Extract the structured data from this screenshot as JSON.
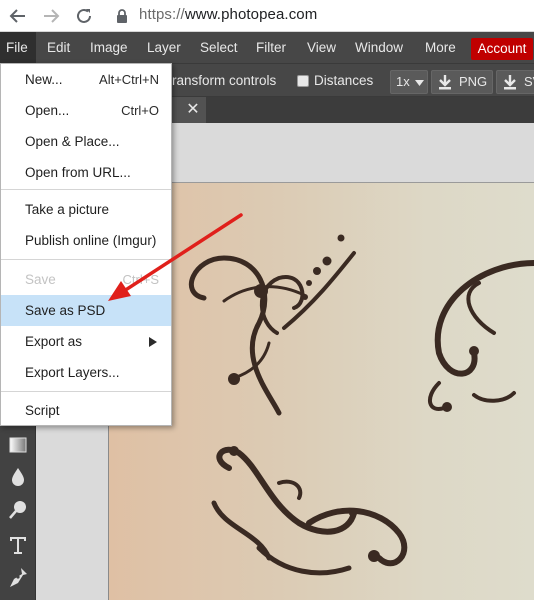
{
  "browser": {
    "url_scheme": "https://",
    "url_host": "www.photopea.com"
  },
  "menubar": {
    "items": [
      "File",
      "Edit",
      "Image",
      "Layer",
      "Select",
      "Filter",
      "View",
      "Window",
      "More"
    ],
    "account_label": "Account"
  },
  "options": {
    "transform_label": "ransform controls",
    "distances_label": "Distances",
    "zoom_value": "1x",
    "png_label": "PNG",
    "svg_label": "SV"
  },
  "file_menu": {
    "new": {
      "label": "New...",
      "shortcut": "Alt+Ctrl+N"
    },
    "open": {
      "label": "Open...",
      "shortcut": "Ctrl+O"
    },
    "open_place": {
      "label": "Open & Place..."
    },
    "open_url": {
      "label": "Open from URL..."
    },
    "take_picture": {
      "label": "Take a picture"
    },
    "publish": {
      "label": "Publish online (Imgur)"
    },
    "save": {
      "label": "Save",
      "shortcut": "Ctrl+S"
    },
    "save_psd": {
      "label": "Save as PSD"
    },
    "export_as": {
      "label": "Export as"
    },
    "export_layers": {
      "label": "Export Layers..."
    },
    "script": {
      "label": "Script"
    }
  },
  "colors": {
    "accent": "#c00000",
    "highlight": "#c7e2f8",
    "annotation_arrow": "#e0201b",
    "ornament": "#3a2a22"
  },
  "icons": [
    "back-arrow-icon",
    "forward-arrow-icon",
    "reload-icon",
    "lock-icon",
    "download-icon",
    "close-icon",
    "gradient-tool-icon",
    "blur-tool-icon",
    "dodge-tool-icon",
    "type-tool-icon",
    "pen-tool-icon",
    "submenu-arrow-icon"
  ]
}
